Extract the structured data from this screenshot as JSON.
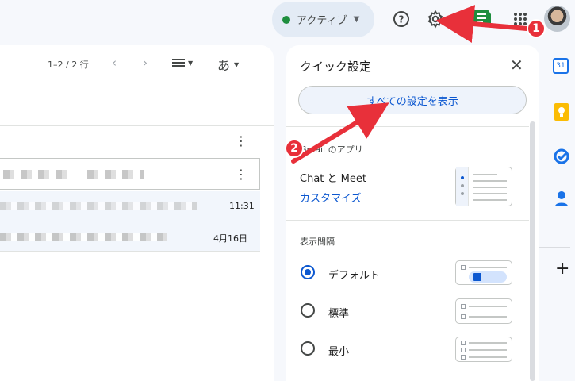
{
  "topbar": {
    "status_label": "アクティブ",
    "status_color": "#1e8e3e",
    "help_icon": "help-circle-icon",
    "settings_icon": "gear-icon",
    "apps_icon": "apps-grid-icon"
  },
  "list": {
    "pager_text": "1–2 / 2 行",
    "input_tool_label": "あ",
    "rows": [
      {
        "date": "11:31"
      },
      {
        "date": "4月16日"
      }
    ]
  },
  "quick_settings": {
    "title": "クイック設定",
    "all_settings_button": "すべての設定を表示",
    "apps_section_label": "Gmail のアプリ",
    "apps_item_title": "Chat と Meet",
    "apps_item_link": "カスタマイズ",
    "density_section_label": "表示間隔",
    "density_options": [
      {
        "label": "デフォルト",
        "selected": true
      },
      {
        "label": "標準",
        "selected": false
      },
      {
        "label": "最小",
        "selected": false
      }
    ]
  },
  "rail": {
    "items": [
      "calendar-icon",
      "keep-icon",
      "tasks-icon",
      "contacts-icon",
      "add-icon"
    ],
    "calendar_day": "31",
    "add_label": "+"
  },
  "annotations": {
    "badge_1": "1",
    "badge_2": "2",
    "color": "#e8303a"
  }
}
